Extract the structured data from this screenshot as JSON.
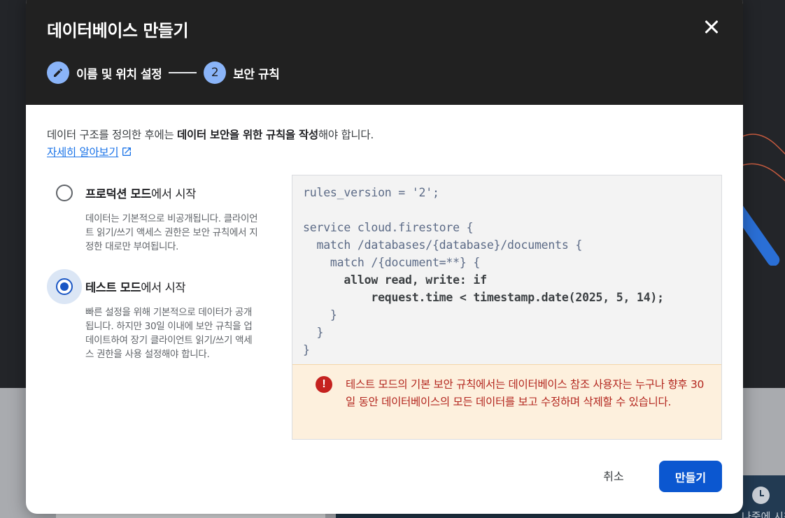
{
  "dialog": {
    "title": "데이터베이스 만들기",
    "steps": [
      {
        "number": "",
        "label": "이름 및 위치 설정",
        "icon": "pencil-icon",
        "status": "completed"
      },
      {
        "number": "2",
        "label": "보안 규칙",
        "status": "active"
      }
    ],
    "intro": {
      "part1": "데이터 구조를 정의한 후에는 ",
      "bold": "데이터 보안을 위한 규칙을 작성",
      "part2": "해야 합니다."
    },
    "learn_more": "자세히 알아보기",
    "options": [
      {
        "title_bold": "프로덕션 모드",
        "title_rest": "에서 시작",
        "description": "데이터는 기본적으로 비공개됩니다. 클라이언트 읽기/쓰기 액세스 권한은 보안 규칙에서 지정한 대로만 부여됩니다.",
        "selected": false
      },
      {
        "title_bold": "테스트 모드",
        "title_rest": "에서 시작",
        "description": "빠른 설정을 위해 기본적으로 데이터가 공개됩니다. 하지만 30일 이내에 보안 규칙을 업데이트하여 장기 클라이언트 읽기/쓰기 액세스 권한을 사용 설정해야 합니다.",
        "selected": true
      }
    ],
    "rules_code": {
      "line1": "rules_version = '2';",
      "line2": "",
      "line3": "service cloud.firestore {",
      "line4": "  match /databases/{database}/documents {",
      "line5": "    match /{document=**} {",
      "line6": "      allow read, write: if",
      "line7": "          request.time < timestamp.date(2025, 5, 14);",
      "line8": "    }",
      "line9": "  }",
      "line10": "}"
    },
    "warning": "테스트 모드의 기본 보안 규칙에서는 데이터베이스 참조 사용자는 누구나 향후 30일 동안 데이터베이스의 모든 데이터를 보고 수정하며 삭제할 수 있습니다.",
    "cancel_label": "취소",
    "create_label": "만들기"
  },
  "background": {
    "partial_text": "나중에 시청"
  },
  "colors": {
    "header_bg": "#212121",
    "primary": "#0b57d0",
    "step_circle": "#8ab4f8",
    "warning_bg": "#fdf0dd",
    "warning_text": "#b3261e"
  }
}
